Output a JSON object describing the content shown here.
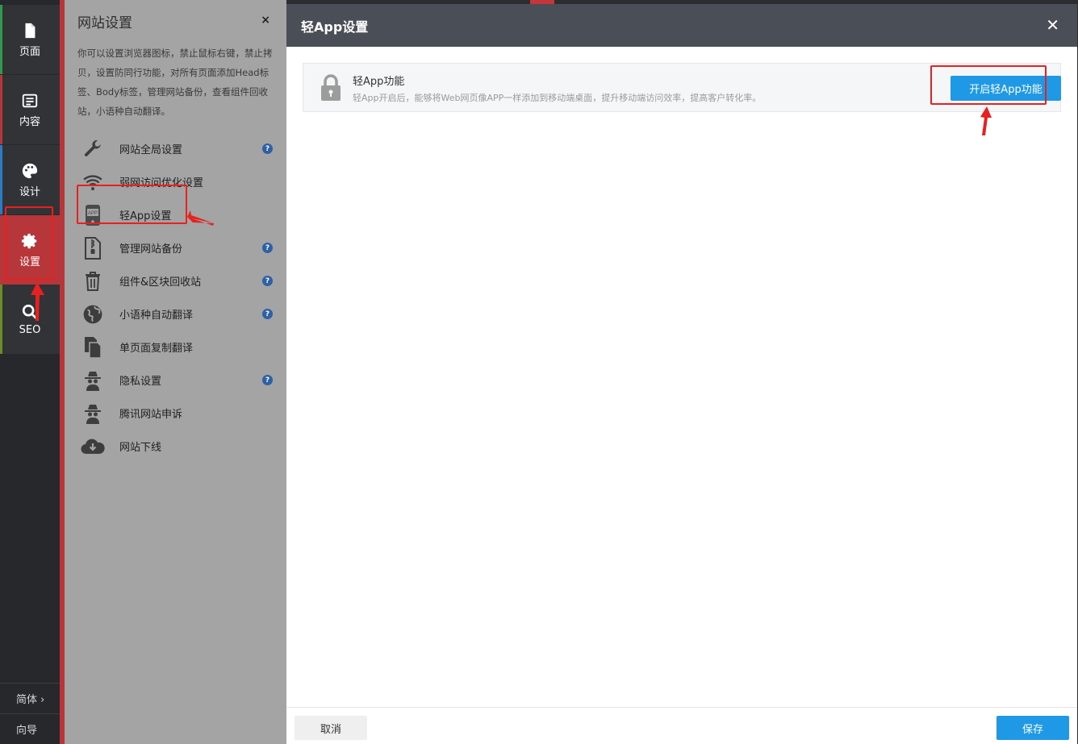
{
  "rail": {
    "items": [
      {
        "label": "页面",
        "icon": "page-icon",
        "accent": "#2e9a4e"
      },
      {
        "label": "内容",
        "icon": "list-icon",
        "accent": "#b7363a"
      },
      {
        "label": "设计",
        "icon": "palette-icon",
        "accent": "#2a7cc7"
      },
      {
        "label": "设置",
        "icon": "gear-icon",
        "accent": "#b7363a"
      },
      {
        "label": "SEO",
        "icon": "search-icon",
        "accent": "#6b8e23"
      }
    ],
    "language": "简体 ›",
    "guide": "向导"
  },
  "panel": {
    "title": "网站设置",
    "close": "×",
    "description": "你可以设置浏览器图标，禁止鼠标右键，禁止拷贝，设置防同行功能，对所有页面添加Head标签、Body标签，管理网站备份，查看组件回收站，小语种自动翻译。",
    "menu": [
      {
        "label": "网站全局设置",
        "icon": "wrench-icon",
        "help": "?"
      },
      {
        "label": "弱网访问优化设置",
        "icon": "wifi-icon"
      },
      {
        "label": "轻App设置",
        "icon": "app-icon"
      },
      {
        "label": "管理网站备份",
        "icon": "zip-file-icon",
        "help": "?"
      },
      {
        "label": "组件&区块回收站",
        "icon": "trash-icon",
        "help": "?"
      },
      {
        "label": "小语种自动翻译",
        "icon": "globe-icon",
        "help": "?"
      },
      {
        "label": "单页面复制翻译",
        "icon": "copy-icon"
      },
      {
        "label": "隐私设置",
        "icon": "spy-icon",
        "help": "?"
      },
      {
        "label": "腾讯网站申诉",
        "icon": "spy-icon"
      },
      {
        "label": "网站下线",
        "icon": "cloud-download-icon"
      }
    ]
  },
  "dialog": {
    "title": "轻App设置",
    "close": "✕",
    "feature": {
      "title": "轻App功能",
      "description": "轻App开启后，能够将Web网页像APP一样添加到移动端桌面，提升移动端访问效率，提高客户转化率。",
      "button": "开启轻App功能"
    },
    "cancel": "取消",
    "save": "保存"
  },
  "colors": {
    "accent_blue": "#1f99e6",
    "active_red": "#b7363a",
    "annotation_red": "#e82020"
  }
}
